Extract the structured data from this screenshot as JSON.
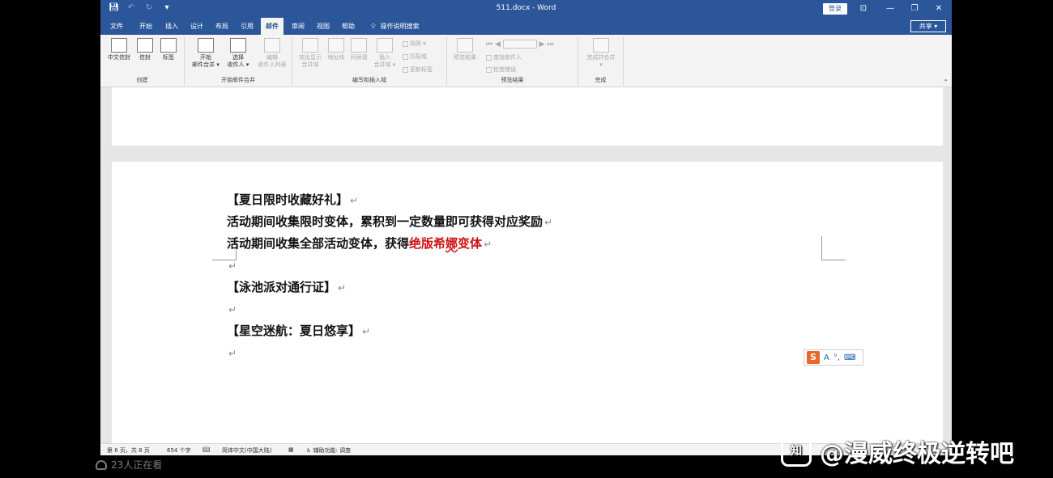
{
  "window": {
    "title": "511.docx - Word",
    "login_label": "登录",
    "controls": {
      "ribbon_display": "⊡",
      "minimize": "—",
      "restore": "❐",
      "close": "✕"
    },
    "quick_access": {
      "save_icon": "save-icon",
      "undo_icon": "undo-icon",
      "redo_icon": "redo-icon",
      "customize": "▾"
    }
  },
  "tabs": [
    {
      "label": "文件"
    },
    {
      "label": "开始"
    },
    {
      "label": "插入"
    },
    {
      "label": "设计"
    },
    {
      "label": "布局"
    },
    {
      "label": "引用"
    },
    {
      "label": "邮件"
    },
    {
      "label": "审阅"
    },
    {
      "label": "视图"
    },
    {
      "label": "帮助"
    }
  ],
  "active_tab": "邮件",
  "tell_me": {
    "label": "操作说明搜索",
    "icon": "lightbulb-icon"
  },
  "share": {
    "label": "共享 ▾"
  },
  "ribbon": {
    "groups": [
      {
        "label": "创建",
        "buttons": [
          "中文信封",
          "信封",
          "标签"
        ]
      },
      {
        "label": "开始邮件合并",
        "buttons": [
          "开始\n邮件合并 ▾",
          "选择\n收件人 ▾",
          "编辑\n收件人列表"
        ]
      },
      {
        "label": "编写和插入域",
        "buttons": [
          "突出显示\n合并域",
          "地址块",
          "问候语",
          "插入\n合并域 ▾"
        ],
        "small": [
          "规则 ▾",
          "匹配域",
          "更新标签"
        ]
      },
      {
        "label": "预览结果",
        "buttons": [
          "预览结果"
        ],
        "small": [
          "查找收件人",
          "检查错误"
        ]
      },
      {
        "label": "完成",
        "buttons": [
          "完成并合并\n▾"
        ]
      }
    ],
    "collapse": "⌃"
  },
  "document": {
    "paragraphs": [
      {
        "text": "【夏日限时收藏好礼】"
      },
      {
        "text": "活动期间收集限时变体，累积到一定数量即可获得对应奖励"
      },
      {
        "text_before": "活动期间收集全部活动变体，获得",
        "text_red_1": "绝版希",
        "text_red_squiggle": "娜",
        "text_red_2": "变体"
      },
      {
        "text": ""
      },
      {
        "text": "【泳池派对通行证】"
      },
      {
        "text": ""
      },
      {
        "text": "【星空迷航：夏日悠享】"
      },
      {
        "text": ""
      }
    ],
    "paragraph_mark": "↵",
    "red_color": "#d01010"
  },
  "ime_bar": {
    "logo": "S",
    "items": [
      "A",
      "°,",
      "⌨"
    ]
  },
  "status_bar": {
    "page": "第 6 页，共 8 页",
    "words": "654 个字",
    "language": "简体中文(中国大陆)",
    "accessibility": "辅助功能: 调查"
  },
  "overlay": {
    "viewers": "23人正在看",
    "watermark": "@漫威终极逆转吧",
    "watermark_logo": "知"
  }
}
